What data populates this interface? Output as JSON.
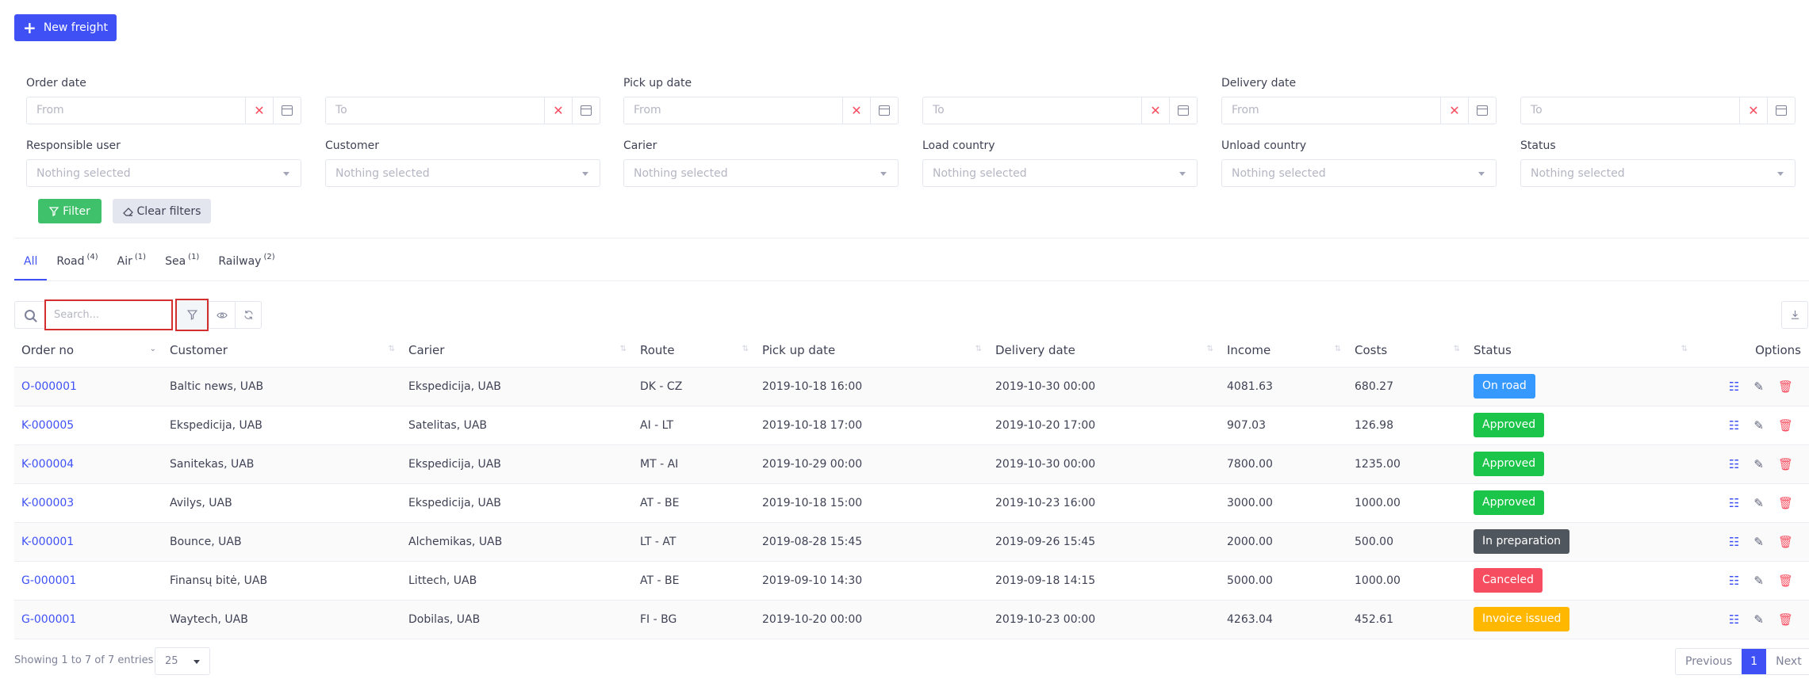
{
  "actions": {
    "new_freight": "New freight"
  },
  "filters": {
    "date_groups": [
      {
        "label": "Order date",
        "from": "From",
        "to": "To"
      },
      {
        "label": "Pick up date",
        "from": "From",
        "to": "To"
      },
      {
        "label": "Delivery date",
        "from": "From",
        "to": "To"
      }
    ],
    "selects": [
      {
        "label": "Responsible user",
        "value": "Nothing selected"
      },
      {
        "label": "Customer",
        "value": "Nothing selected"
      },
      {
        "label": "Carier",
        "value": "Nothing selected"
      },
      {
        "label": "Load country",
        "value": "Nothing selected"
      },
      {
        "label": "Unload country",
        "value": "Nothing selected"
      },
      {
        "label": "Status",
        "value": "Nothing selected"
      }
    ],
    "filter_button": "Filter",
    "clear_button": "Clear filters"
  },
  "tabs": [
    {
      "label": "All",
      "count": ""
    },
    {
      "label": "Road",
      "count": "(4)"
    },
    {
      "label": "Air",
      "count": "(1)"
    },
    {
      "label": "Sea",
      "count": "(1)"
    },
    {
      "label": "Railway",
      "count": "(2)"
    }
  ],
  "toolbar": {
    "search_placeholder": "Search..."
  },
  "table": {
    "columns": [
      "Order no",
      "Customer",
      "Carier",
      "Route",
      "Pick up date",
      "Delivery date",
      "Income",
      "Costs",
      "Status",
      "Options"
    ],
    "rows": [
      {
        "order": "O-000001",
        "customer": "Baltic news, UAB",
        "carier": "Ekspedicija, UAB",
        "route": "DK - CZ",
        "pickup": "2019-10-18 16:00",
        "delivery": "2019-10-30 00:00",
        "income": "4081.63",
        "costs": "680.27",
        "status": "On road",
        "status_color": "#3699ff"
      },
      {
        "order": "K-000005",
        "customer": "Ekspedicija, UAB",
        "carier": "Satelitas, UAB",
        "route": "AI - LT",
        "pickup": "2019-10-18 17:00",
        "delivery": "2019-10-20 17:00",
        "income": "907.03",
        "costs": "126.98",
        "status": "Approved",
        "status_color": "#1bc549"
      },
      {
        "order": "K-000004",
        "customer": "Sanitekas, UAB",
        "carier": "Ekspedicija, UAB",
        "route": "MT - AI",
        "pickup": "2019-10-29 00:00",
        "delivery": "2019-10-30 00:00",
        "income": "7800.00",
        "costs": "1235.00",
        "status": "Approved",
        "status_color": "#1bc549"
      },
      {
        "order": "K-000003",
        "customer": "Avilys, UAB",
        "carier": "Ekspedicija, UAB",
        "route": "AT - BE",
        "pickup": "2019-10-18 15:00",
        "delivery": "2019-10-23 16:00",
        "income": "3000.00",
        "costs": "1000.00",
        "status": "Approved",
        "status_color": "#1bc549"
      },
      {
        "order": "K-000001",
        "customer": "Bounce, UAB",
        "carier": "Alchemikas, UAB",
        "route": "LT - AT",
        "pickup": "2019-08-28 15:45",
        "delivery": "2019-09-26 15:45",
        "income": "2000.00",
        "costs": "500.00",
        "status": "In preparation",
        "status_color": "#50565d"
      },
      {
        "order": "G-000001",
        "customer": "Finansų bitė, UAB",
        "carier": "Littech, UAB",
        "route": "AT - BE",
        "pickup": "2019-09-10 14:30",
        "delivery": "2019-09-18 14:15",
        "income": "5000.00",
        "costs": "1000.00",
        "status": "Canceled",
        "status_color": "#f64e60"
      },
      {
        "order": "G-000001",
        "customer": "Waytech, UAB",
        "carier": "Dobilas, UAB",
        "route": "FI - BG",
        "pickup": "2019-10-20 00:00",
        "delivery": "2019-10-23 00:00",
        "income": "4263.04",
        "costs": "452.61",
        "status": "Invoice issued",
        "status_color": "#ffb700"
      }
    ]
  },
  "footer": {
    "info": "Showing 1 to 7 of 7 entries",
    "page_size": "25",
    "prev": "Previous",
    "page": "1",
    "next": "Next"
  },
  "colors": {
    "primary": "#3f51f5",
    "success": "#3ec16a",
    "danger": "#f64e60",
    "highlight": "#d32f2f"
  }
}
